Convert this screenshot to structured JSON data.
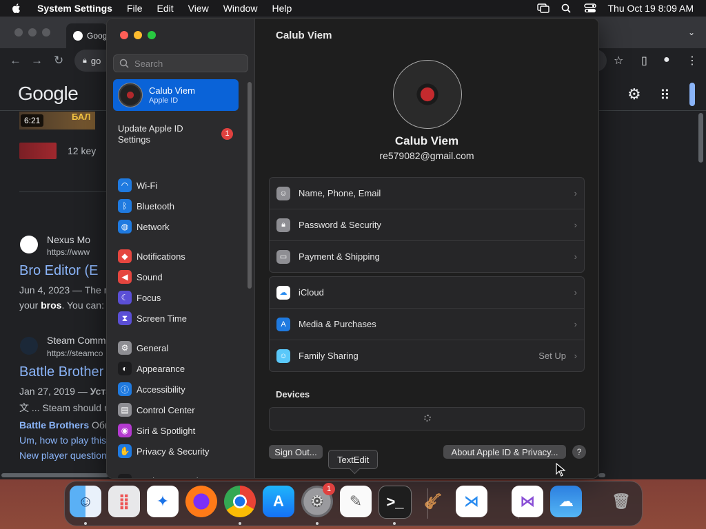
{
  "menubar": {
    "app_name": "System Settings",
    "items": [
      "File",
      "Edit",
      "View",
      "Window",
      "Help"
    ],
    "clock": "Thu Oct 19  8:09 AM"
  },
  "browser": {
    "tab_title": "Goog",
    "omnibox_text": "go",
    "google_logo": "Google",
    "video_time": "6:21",
    "video_caption": "БАЛ",
    "keyboard_text": "12 key",
    "results": [
      {
        "site": "Nexus Mo",
        "url": "https://www",
        "title": "Bro Editor (E",
        "snippet1_date": "Jun 4, 2023 — ",
        "snippet1": "The m",
        "snippet2_bold": "bros",
        "snippet2_pre": "your ",
        "snippet2_post": ". You can: "
      },
      {
        "site": "Steam Comm",
        "url": "https://steamco",
        "title": "Battle Brother",
        "snippet1_date": "Jan 27, 2019 — ",
        "snippet1": "Уста",
        "snippet2": "文 ... Steam should n"
      }
    ],
    "links": [
      "Battle Brothers",
      "Общ",
      "Um, how to play this",
      "New player question"
    ]
  },
  "settings": {
    "title": "Calub Viem",
    "search_placeholder": "Search",
    "account": {
      "name": "Calub Viem",
      "subtitle": "Apple ID"
    },
    "update": {
      "label": "Update Apple ID Settings",
      "badge": "1"
    },
    "sidebar_items": [
      {
        "label": "Wi-Fi",
        "icon": "wifi-icon",
        "color": "#1f7ae0"
      },
      {
        "label": "Bluetooth",
        "icon": "bluetooth-icon",
        "color": "#1f7ae0"
      },
      {
        "label": "Network",
        "icon": "globe-icon",
        "color": "#1f7ae0"
      },
      {
        "label": "Notifications",
        "icon": "bell-icon",
        "color": "#e5463f"
      },
      {
        "label": "Sound",
        "icon": "speaker-icon",
        "color": "#e5463f"
      },
      {
        "label": "Focus",
        "icon": "moon-icon",
        "color": "#5b4fd6"
      },
      {
        "label": "Screen Time",
        "icon": "hourglass-icon",
        "color": "#5b4fd6"
      },
      {
        "label": "General",
        "icon": "gear-icon",
        "color": "#8e8e93"
      },
      {
        "label": "Appearance",
        "icon": "appearance-icon",
        "color": "#1c1c1e"
      },
      {
        "label": "Accessibility",
        "icon": "accessibility-icon",
        "color": "#1f7ae0"
      },
      {
        "label": "Control Center",
        "icon": "control-center-icon",
        "color": "#8e8e93"
      },
      {
        "label": "Siri & Spotlight",
        "icon": "siri-icon",
        "color": "#b43ad0"
      },
      {
        "label": "Privacy & Security",
        "icon": "hand-icon",
        "color": "#1f7ae0"
      },
      {
        "label": "Desktop & Dock",
        "icon": "dock-icon",
        "color": "#1c1c1e"
      }
    ],
    "profile": {
      "name": "Calub Viem",
      "email": "re579082@gmail.com"
    },
    "group1": [
      {
        "label": "Name, Phone, Email",
        "icon": "contact-icon",
        "color": "#8e8e93"
      },
      {
        "label": "Password & Security",
        "icon": "lock-icon",
        "color": "#8e8e93"
      },
      {
        "label": "Payment & Shipping",
        "icon": "card-icon",
        "color": "#8e8e93"
      }
    ],
    "group2": [
      {
        "label": "iCloud",
        "icon": "icloud-icon",
        "color": "#ffffff"
      },
      {
        "label": "Media & Purchases",
        "icon": "appstore-icon",
        "color": "#1f7ae0"
      },
      {
        "label": "Family Sharing",
        "icon": "family-icon",
        "color": "#5ac8fa",
        "detail": "Set Up"
      }
    ],
    "devices_title": "Devices",
    "sign_out": "Sign Out...",
    "about": "About Apple ID & Privacy...",
    "help": "?"
  },
  "tooltip": "TextEdit",
  "dock": {
    "apps": [
      "finder-icon",
      "launchpad-icon",
      "safari-icon",
      "firefox-icon",
      "chrome-icon",
      "app-store-icon",
      "system-settings-icon",
      "textedit-icon",
      "terminal-icon",
      "garageband-icon",
      "vscode-icon",
      "visual-studio-icon",
      "weather-icon",
      "trash-icon"
    ],
    "settings_badge": "1"
  }
}
